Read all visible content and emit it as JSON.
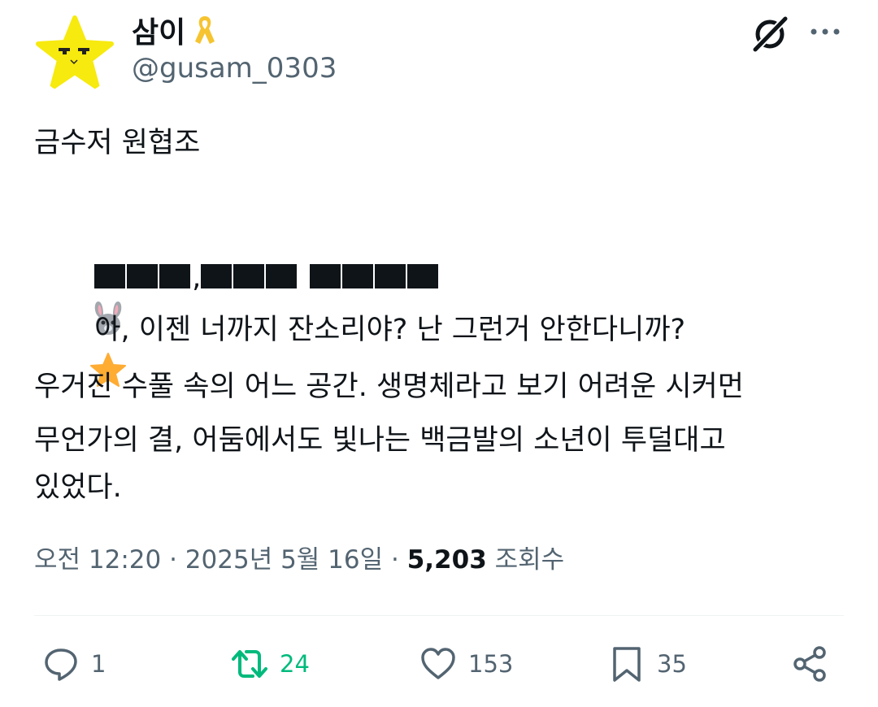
{
  "author": {
    "display_name": "삼이",
    "handle": "@gusam_0303",
    "avatar_icon": "star-face-icon",
    "badge_icon": "yellow-ribbon-icon"
  },
  "header_actions": {
    "grok_icon": "grok-icon",
    "more_icon": "more-icon"
  },
  "tweet": {
    "line1": "금수저 원협조",
    "line2_after_emoji": "아, 이젠 너까지 잔소리야? 난 그런거 안한다니까?",
    "line3": "우거진 수풀 속의 어느 공간. 생명체라고 보기 어려운 시커먼",
    "line4": "무언가의 결, 어둠에서도 빛나는 백금발의 소년이 투덜대고",
    "line5": "있었다.",
    "redacted_separator": ",",
    "emoji_rabbit": "rabbit-face-icon",
    "emoji_star": "star-icon"
  },
  "meta": {
    "time": "오전 12:20",
    "date": "2025년 5월 16일",
    "separator": " · ",
    "views_count": "5,203",
    "views_label": "조회수"
  },
  "actions": {
    "reply_count": "1",
    "retweet_count": "24",
    "like_count": "153",
    "bookmark_count": "35"
  },
  "colors": {
    "text": "#0f1419",
    "secondary": "#536471",
    "retweeted": "#00ba7c",
    "divider": "#eff3f4"
  }
}
